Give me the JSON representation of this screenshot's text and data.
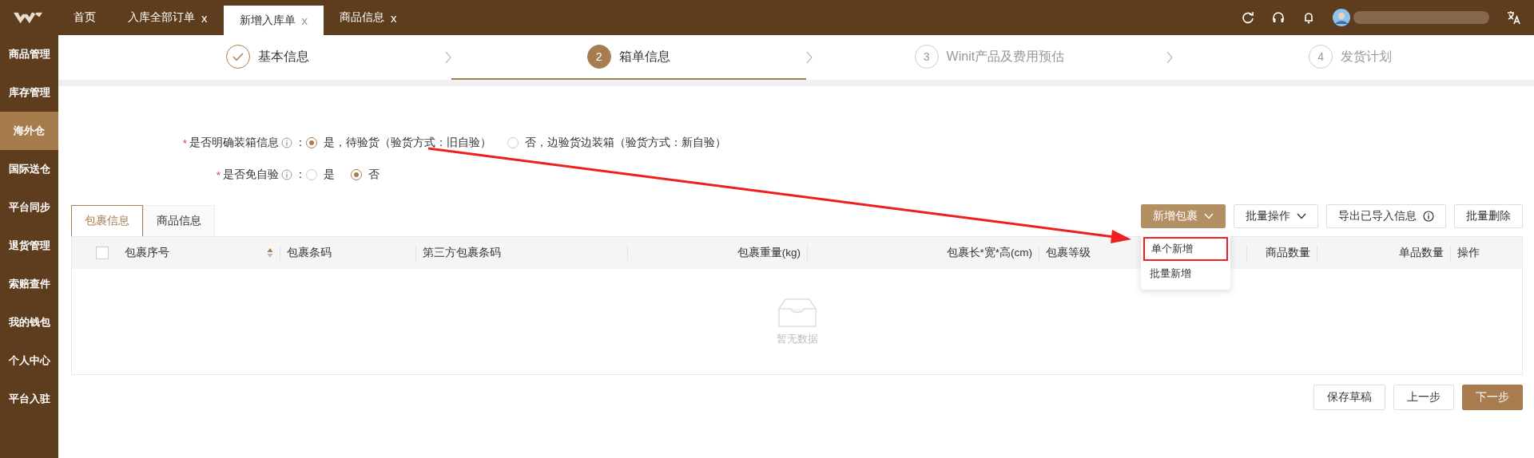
{
  "topbar": {
    "tabs": [
      {
        "label": "首页",
        "selected": false,
        "closable": false
      },
      {
        "label": "入库全部订单",
        "selected": false,
        "closable": true,
        "close": "x"
      },
      {
        "label": "新增入库单",
        "selected": true,
        "closable": true,
        "close": "x"
      },
      {
        "label": "商品信息",
        "selected": false,
        "closable": true,
        "close": "x"
      }
    ]
  },
  "sidebar": {
    "items": [
      {
        "label": "商品管理",
        "selected": false
      },
      {
        "label": "库存管理",
        "selected": false
      },
      {
        "label": "海外仓",
        "selected": true
      },
      {
        "label": "国际送仓",
        "selected": false
      },
      {
        "label": "平台同步",
        "selected": false
      },
      {
        "label": "退货管理",
        "selected": false
      },
      {
        "label": "索赔查件",
        "selected": false
      },
      {
        "label": "我的钱包",
        "selected": false
      },
      {
        "label": "个人中心",
        "selected": false
      },
      {
        "label": "平台入驻",
        "selected": false
      }
    ]
  },
  "steps": [
    {
      "label": "基本信息",
      "completed": true,
      "selected": false
    },
    {
      "number": "2",
      "label": "箱单信息",
      "completed": false,
      "selected": true
    },
    {
      "number": "3",
      "label": "Winit产品及费用预估",
      "completed": false,
      "selected": false
    },
    {
      "number": "4",
      "label": "发货计划",
      "completed": false,
      "selected": false
    }
  ],
  "form": {
    "fields": [
      {
        "required_mark": "*",
        "label": "是否明确装箱信息",
        "info": true,
        "colon": "：",
        "options": [
          {
            "label": "是，待验货（验货方式：旧自验）",
            "selected": true
          },
          {
            "label": "否，边验货边装箱（验货方式：新自验）",
            "selected": false
          }
        ]
      },
      {
        "required_mark": "*",
        "label": "是否免自验",
        "info": true,
        "colon": "：",
        "options": [
          {
            "label": "是",
            "selected": false
          },
          {
            "label": "否",
            "selected": true
          }
        ]
      }
    ]
  },
  "tabs": [
    {
      "label": "包裹信息",
      "selected": true
    },
    {
      "label": "商品信息",
      "selected": false
    }
  ],
  "toolbar": {
    "buttons": [
      {
        "label": "新增包裹",
        "kind": "primary",
        "dropdown": true,
        "info": false
      },
      {
        "label": "批量操作",
        "kind": "default",
        "dropdown": true,
        "info": false
      },
      {
        "label": "导出已导入信息",
        "kind": "default",
        "dropdown": false,
        "info": true
      },
      {
        "label": "批量删除",
        "kind": "default",
        "dropdown": false,
        "info": false
      }
    ]
  },
  "dropdown": {
    "items": [
      {
        "label": "单个新增",
        "highlighted": true
      },
      {
        "label": "批量新增",
        "highlighted": false
      }
    ]
  },
  "table": {
    "select_all_checked": false,
    "columns": [
      {
        "label": "包裹序号",
        "sortable": true
      },
      {
        "label": "包裹条码"
      },
      {
        "label": "第三方包裹条码"
      },
      {
        "label": "包裹重量(kg)"
      },
      {
        "label": "包裹长*宽*高(cm)"
      },
      {
        "label": "包裹等级"
      },
      {
        "label": "商品数量"
      },
      {
        "label": "单品数量"
      },
      {
        "label": "操作"
      }
    ],
    "empty_text": "暂无数据"
  },
  "footer_buttons": [
    {
      "label": "保存草稿",
      "kind": "default"
    },
    {
      "label": "上一步",
      "kind": "default"
    },
    {
      "label": "下一步",
      "kind": "primary"
    }
  ]
}
